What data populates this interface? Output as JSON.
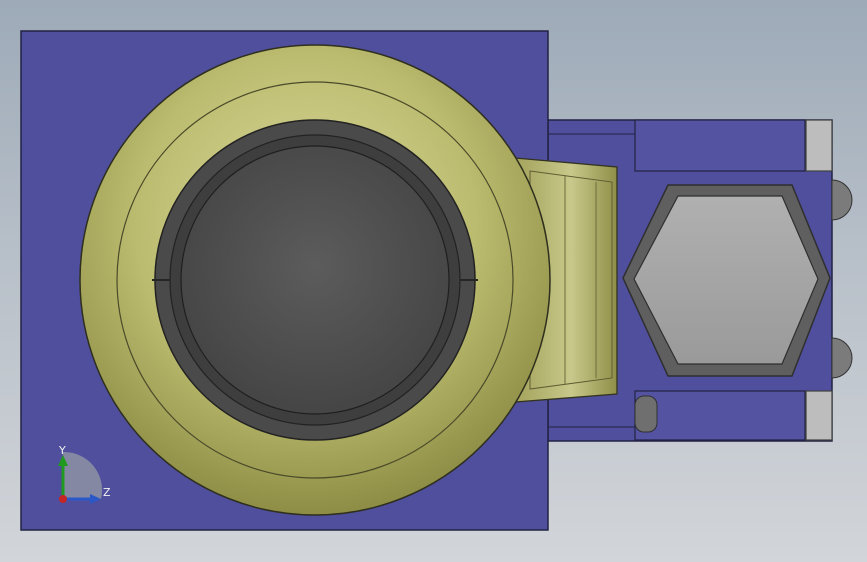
{
  "viewport": {
    "view_name": "cad-graphics-area",
    "triad": {
      "y_label": "Y",
      "z_label": "Z"
    }
  },
  "colors": {
    "background_top": "#9daab8",
    "background_bottom": "#d2d5d9",
    "plate_blue": "#4f4f9d",
    "plate_edge": "#222244",
    "ring_olive": "#b9b86a",
    "ring_olive_dark": "#8f8f47",
    "dark_gray": "#4f4f4f",
    "mid_gray": "#6b6b6b",
    "light_gray": "#a4a4a4",
    "triad_y": "#1f9a1f",
    "triad_z": "#2b58c8",
    "triad_origin": "#c52525"
  },
  "model_parts": [
    "mount-plate",
    "wheel-housing",
    "wheel-insert",
    "neck-bracket",
    "side-block",
    "hex-bolt",
    "side-screws"
  ]
}
